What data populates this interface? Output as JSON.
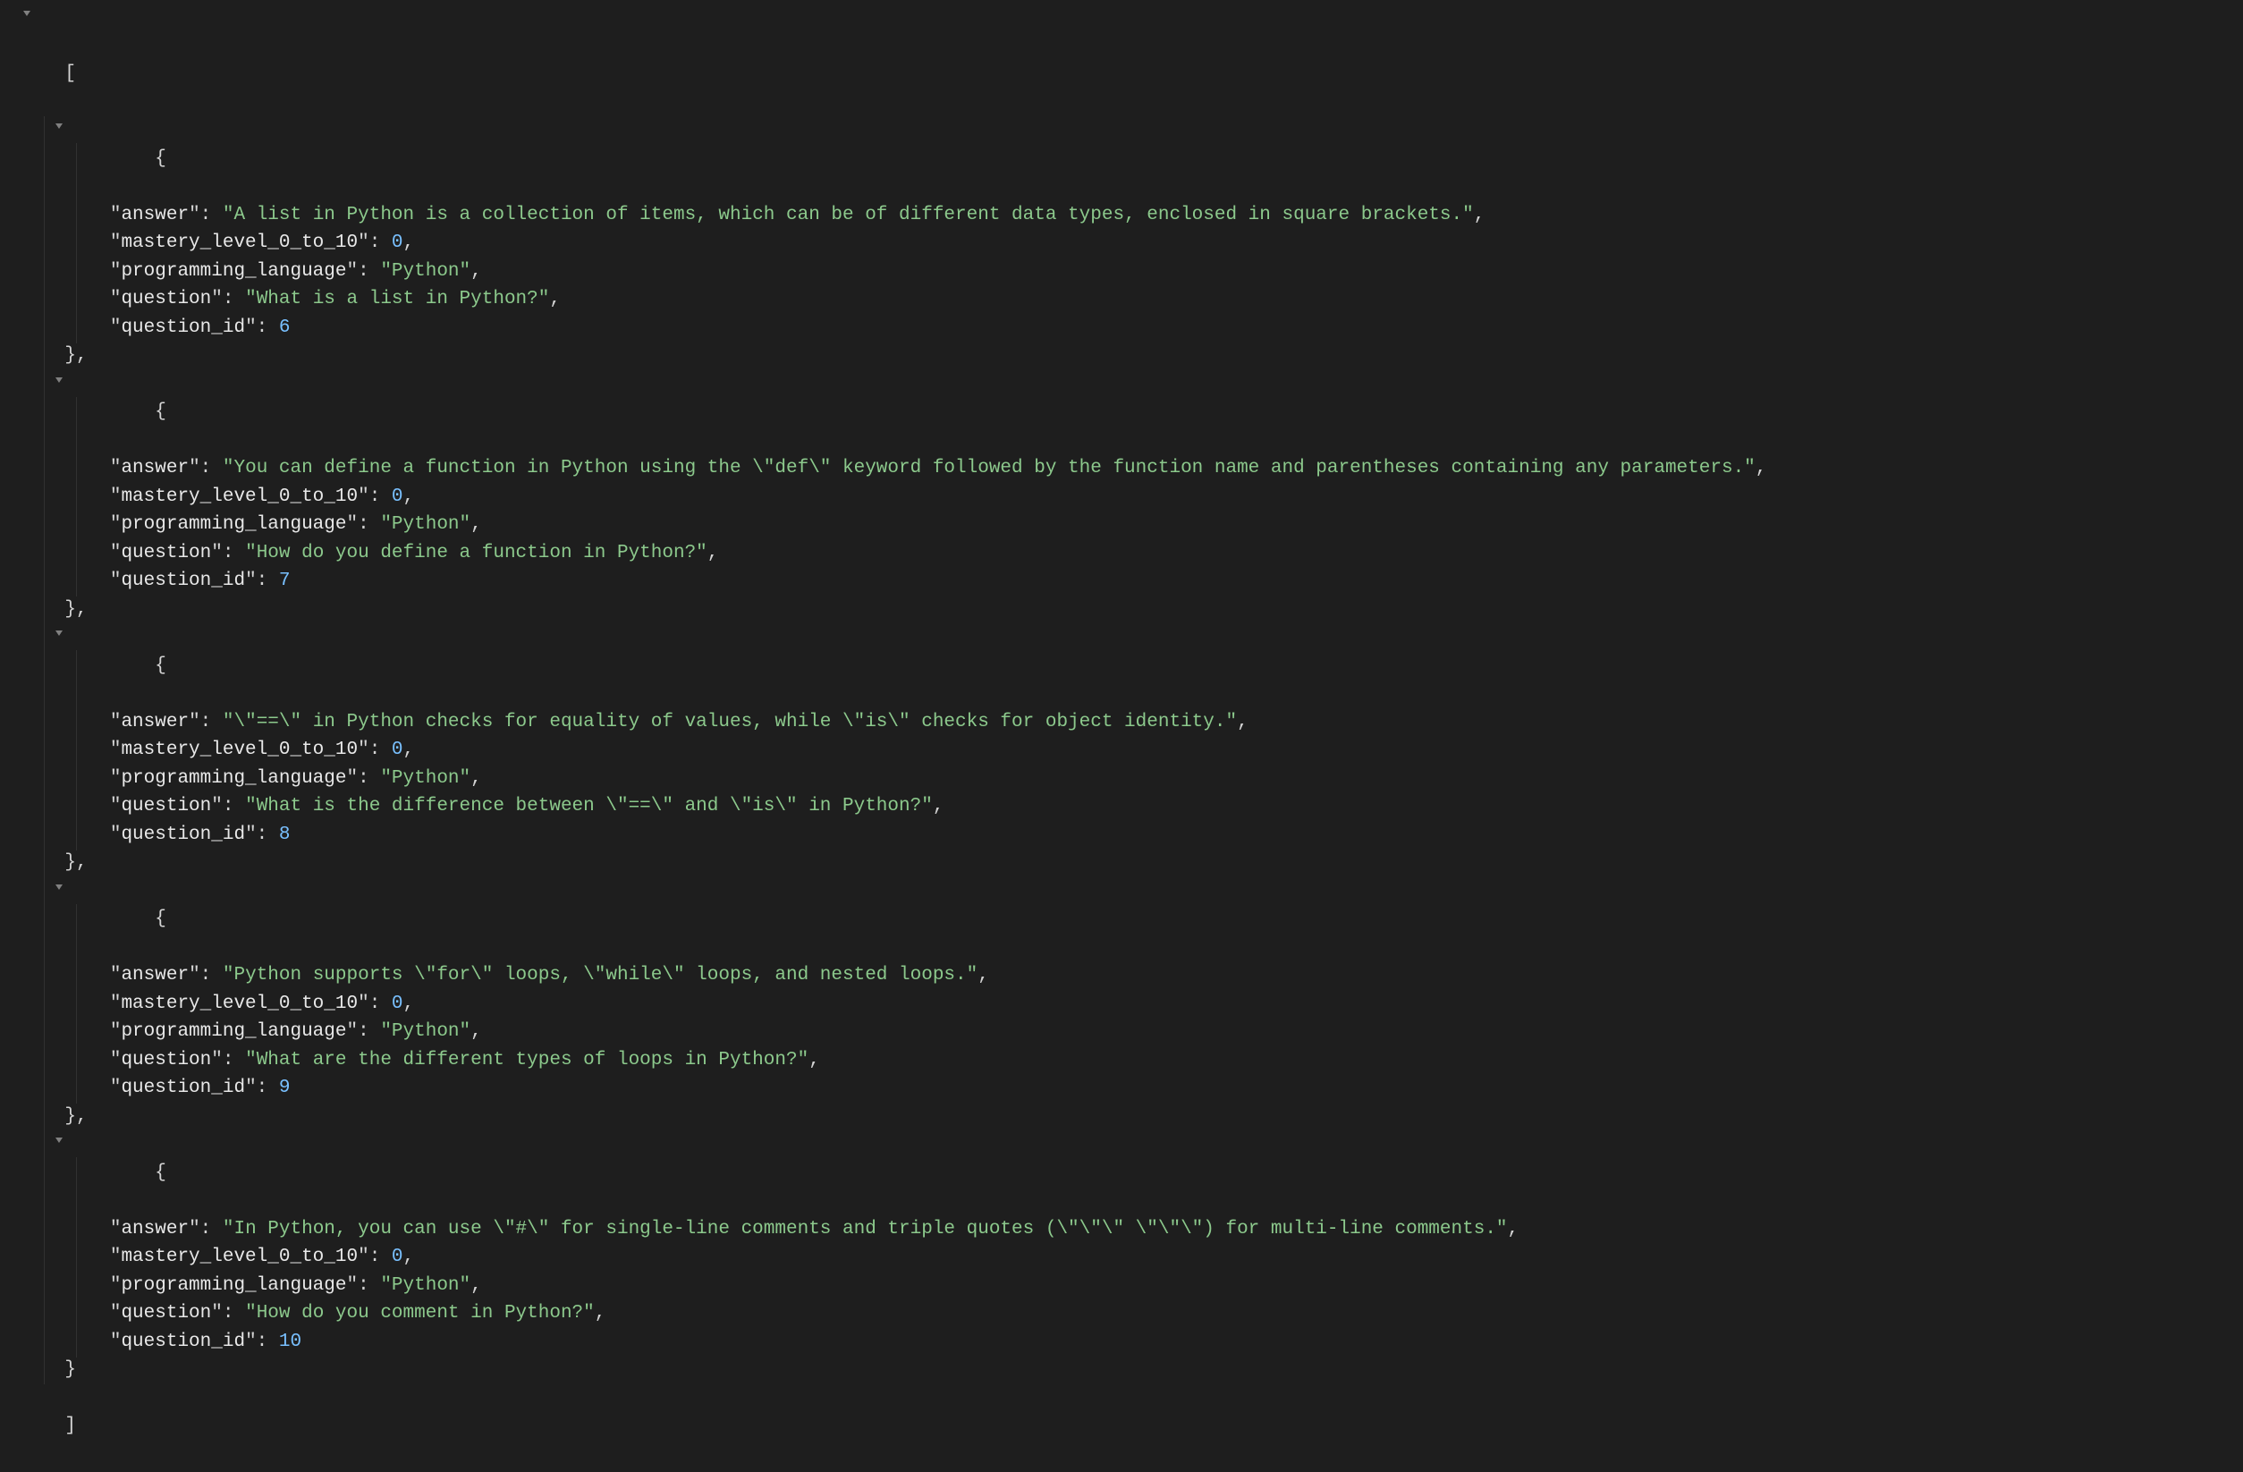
{
  "colors": {
    "background": "#1e1e1e",
    "key": "#e8e8e8",
    "string": "#8cc98c",
    "number": "#79c0ff",
    "punctuation": "#d4d4d4",
    "caret": "#808080"
  },
  "tokens": {
    "open_bracket": "[",
    "close_bracket": "]",
    "open_brace": "{",
    "close_brace_comma": "},",
    "close_brace": "}",
    "colon_space": ": ",
    "comma": ",",
    "quote": "\""
  },
  "indent": {
    "lvl1": "    ",
    "lvl2": "        "
  },
  "keys": {
    "answer": "answer",
    "mastery": "mastery_level_0_to_10",
    "lang": "programming_language",
    "question": "question",
    "qid": "question_id"
  },
  "items": [
    {
      "answer": "\"A list in Python is a collection of items, which can be of different data types, enclosed in square brackets.\"",
      "mastery": "0",
      "lang": "\"Python\"",
      "question": "\"What is a list in Python?\"",
      "qid": "6"
    },
    {
      "answer": "\"You can define a function in Python using the \\\"def\\\" keyword followed by the function name and parentheses containing any parameters.\"",
      "mastery": "0",
      "lang": "\"Python\"",
      "question": "\"How do you define a function in Python?\"",
      "qid": "7"
    },
    {
      "answer": "\"\\\"==\\\" in Python checks for equality of values, while \\\"is\\\" checks for object identity.\"",
      "mastery": "0",
      "lang": "\"Python\"",
      "question": "\"What is the difference between \\\"==\\\" and \\\"is\\\" in Python?\"",
      "qid": "8"
    },
    {
      "answer": "\"Python supports \\\"for\\\" loops, \\\"while\\\" loops, and nested loops.\"",
      "mastery": "0",
      "lang": "\"Python\"",
      "question": "\"What are the different types of loops in Python?\"",
      "qid": "9"
    },
    {
      "answer": "\"In Python, you can use \\\"#\\\" for single-line comments and triple quotes (\\\"\\\"\\\" \\\"\\\"\\\") for multi-line comments.\"",
      "mastery": "0",
      "lang": "\"Python\"",
      "question": "\"How do you comment in Python?\"",
      "qid": "10"
    }
  ]
}
